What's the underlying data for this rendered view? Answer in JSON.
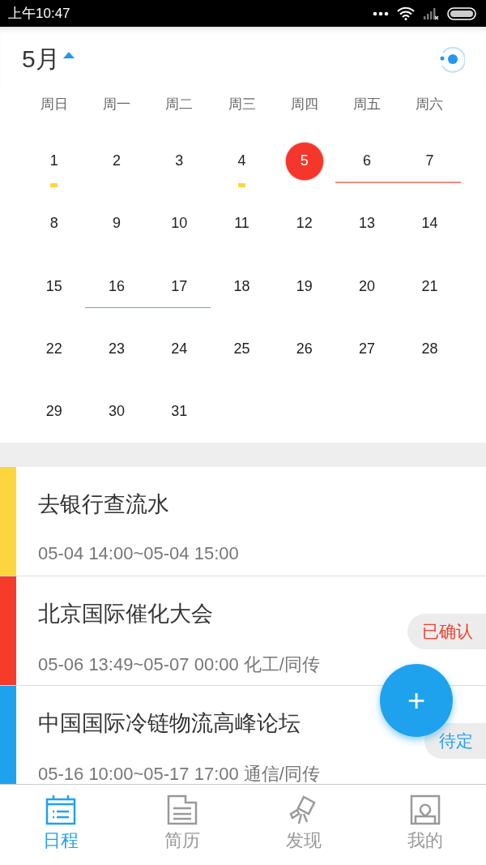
{
  "status_bar": {
    "time": "上午10:47"
  },
  "header": {
    "month": "5月"
  },
  "weekdays": [
    "周日",
    "周一",
    "周二",
    "周三",
    "周四",
    "周五",
    "周六"
  ],
  "weeks": [
    [
      {
        "day": "1",
        "today": false,
        "marked": true
      },
      {
        "day": "2",
        "today": false,
        "marked": false
      },
      {
        "day": "3",
        "today": false,
        "marked": false
      },
      {
        "day": "4",
        "today": false,
        "marked": true
      },
      {
        "day": "5",
        "today": true,
        "marked": false
      },
      {
        "day": "6",
        "today": false,
        "marked": false,
        "color": "#f28a82"
      },
      {
        "day": "7",
        "today": false,
        "marked": false,
        "color": "#f28a82"
      }
    ],
    [
      {
        "day": "8",
        "today": false,
        "marked": false
      },
      {
        "day": "9",
        "today": false,
        "marked": false
      },
      {
        "day": "10",
        "today": false,
        "marked": false
      },
      {
        "day": "11",
        "today": false,
        "marked": false
      },
      {
        "day": "12",
        "today": false,
        "marked": false
      },
      {
        "day": "13",
        "today": false,
        "marked": false
      },
      {
        "day": "14",
        "today": false,
        "marked": false
      }
    ],
    [
      {
        "day": "15",
        "today": false,
        "marked": false
      },
      {
        "day": "16",
        "today": false,
        "marked": false,
        "color": "#5aa9e6"
      },
      {
        "day": "17",
        "today": false,
        "marked": false,
        "color": "#5aa9e6"
      },
      {
        "day": "18",
        "today": false,
        "marked": false
      },
      {
        "day": "19",
        "today": false,
        "marked": false
      },
      {
        "day": "20",
        "today": false,
        "marked": false
      },
      {
        "day": "21",
        "today": false,
        "marked": false
      }
    ],
    [
      {
        "day": "22",
        "today": false,
        "marked": false
      },
      {
        "day": "23",
        "today": false,
        "marked": false
      },
      {
        "day": "24",
        "today": false,
        "marked": false
      },
      {
        "day": "25",
        "today": false,
        "marked": false
      },
      {
        "day": "26",
        "today": false,
        "marked": false
      },
      {
        "day": "27",
        "today": false,
        "marked": false
      },
      {
        "day": "28",
        "today": false,
        "marked": false
      }
    ],
    [
      {
        "day": "29",
        "today": false,
        "marked": false
      },
      {
        "day": "30",
        "today": false,
        "marked": false
      },
      {
        "day": "31",
        "today": false,
        "marked": false
      }
    ]
  ],
  "events": [
    {
      "title": "去银行查流水",
      "time": "05-04 14:00~05-04 15:00",
      "color": "#fdd63f"
    },
    {
      "title": "北京国际催化大会",
      "time": "05-06 13:49~05-07 00:00 化工/同传",
      "color": "#f73b2a",
      "badge": {
        "kind": "confirmed",
        "label": "已确认"
      }
    },
    {
      "title": "中国国际冷链物流高峰论坛",
      "time": "05-16 10:00~05-17 17:00 通信/同传",
      "color": "#1fa2ee",
      "badge": {
        "kind": "pending",
        "label": "待定"
      }
    }
  ],
  "fab": {
    "label": "+"
  },
  "tabs": [
    {
      "kind": "schedule",
      "label": "日程",
      "selected": true
    },
    {
      "kind": "resume",
      "label": "简历",
      "selected": false
    },
    {
      "kind": "discover",
      "label": "发现",
      "selected": false
    },
    {
      "kind": "mine",
      "label": "我的",
      "selected": false
    }
  ]
}
